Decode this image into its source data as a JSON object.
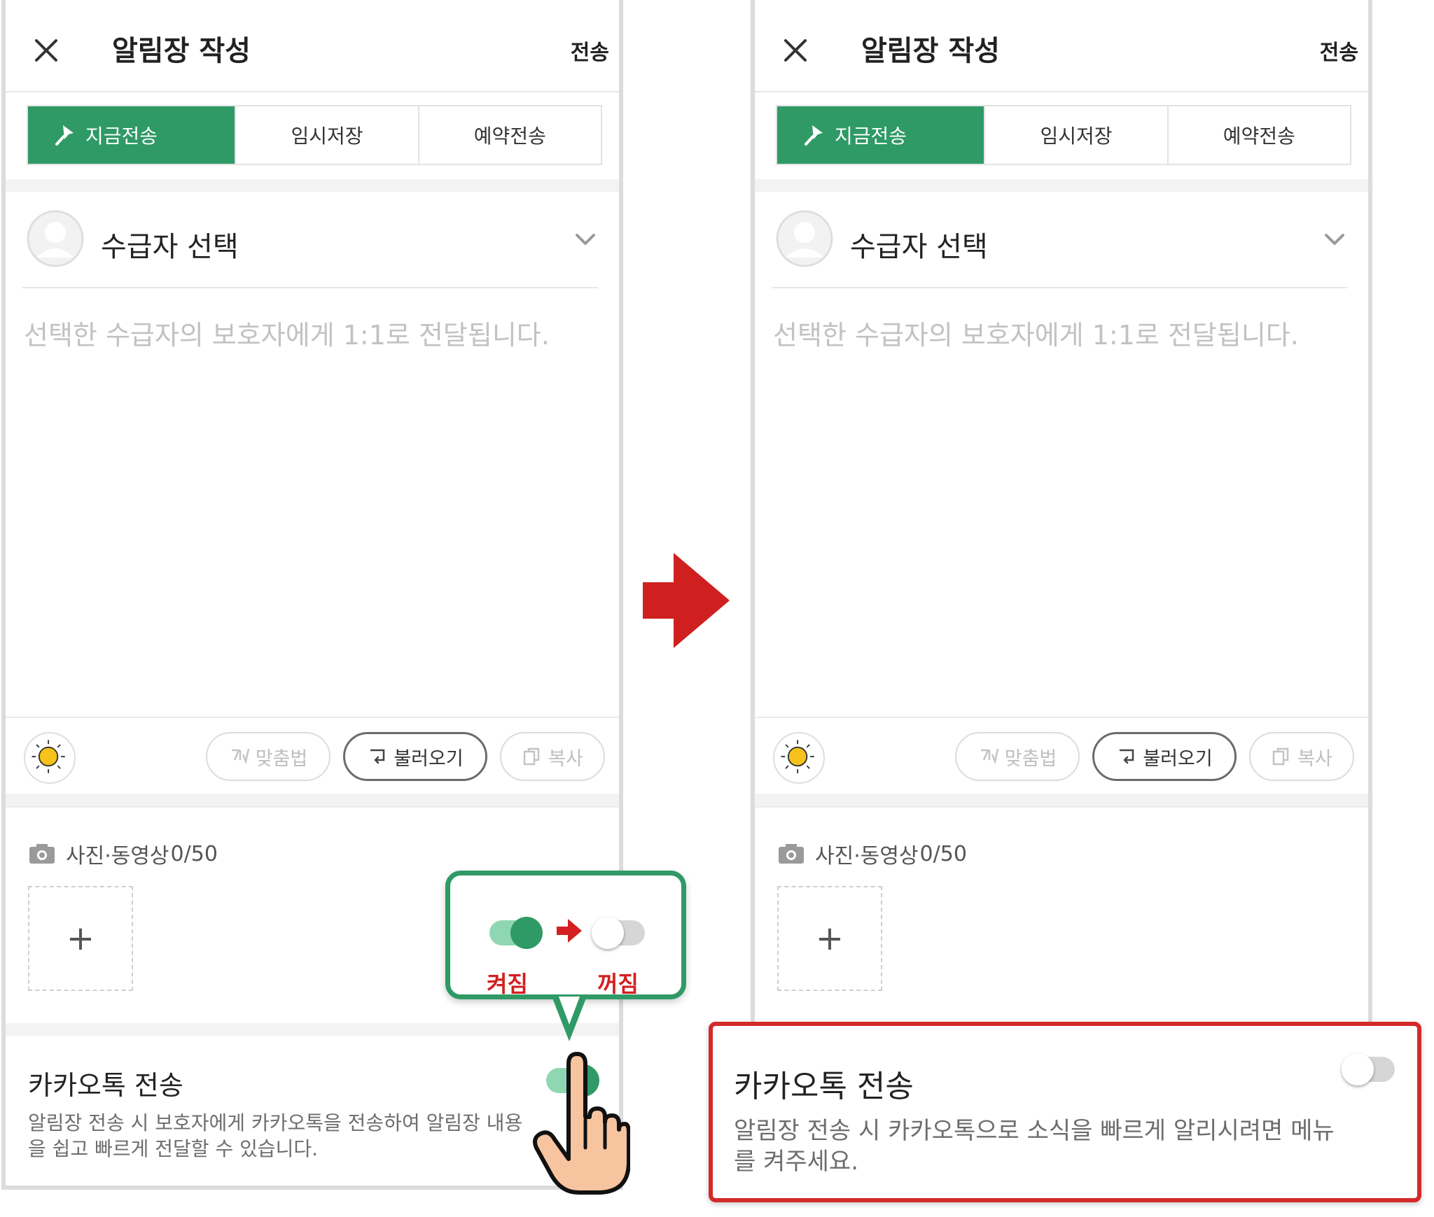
{
  "header": {
    "title": "알림장 작성",
    "send_label": "전송"
  },
  "tabs": [
    {
      "label": "지금전송",
      "active": true,
      "icon": "pin-icon"
    },
    {
      "label": "임시저장",
      "active": false
    },
    {
      "label": "예약전송",
      "active": false
    }
  ],
  "recipient": {
    "label": "수급자 선택"
  },
  "body": {
    "placeholder": "선택한 수급자의 보호자에게 1:1로 전달됩니다."
  },
  "toolbar": {
    "spellcheck_label": "맞춤법",
    "load_label": "불러오기",
    "copy_label": "복사"
  },
  "media": {
    "label": "사진·동영상",
    "count": "0/50",
    "add_symbol": "+"
  },
  "kakao_left": {
    "title": "카카오톡 전송",
    "description": "알림장 전송 시 보호자에게 카카오톡을 전송하여 알림장 내용을 쉽고 빠르게 전달할 수 있습니다.",
    "toggle_state": "on"
  },
  "kakao_right": {
    "title": "카카오톡 전송",
    "description": "알림장 전송 시 카카오톡으로 소식을 빠르게 알리시려면 메뉴를 켜주세요.",
    "toggle_state": "off"
  },
  "callout": {
    "on_label": "켜짐",
    "off_label": "꺼짐"
  },
  "colors": {
    "accent": "#2f9a66",
    "annotation_red": "#d42020"
  }
}
